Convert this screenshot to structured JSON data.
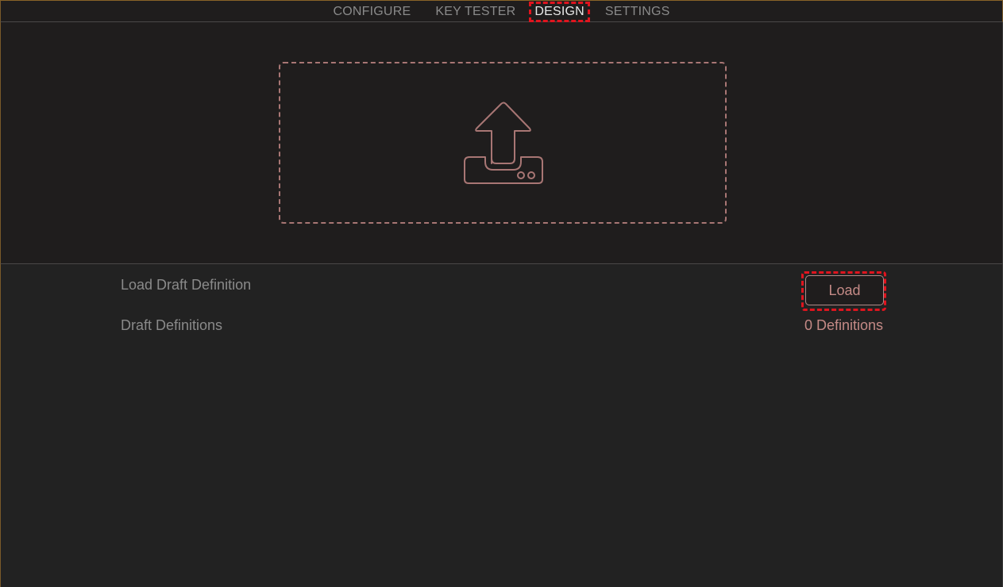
{
  "nav": {
    "tabs": [
      {
        "label": "CONFIGURE",
        "active": false
      },
      {
        "label": "KEY TESTER",
        "active": false
      },
      {
        "label": "DESIGN",
        "active": true
      },
      {
        "label": "SETTINGS",
        "active": false
      }
    ]
  },
  "upload": {
    "icon": "upload-tray-icon"
  },
  "settings": {
    "load_draft": {
      "label": "Load Draft Definition",
      "button_label": "Load"
    },
    "draft_definitions": {
      "label": "Draft Definitions",
      "value": "0 Definitions"
    }
  },
  "colors": {
    "accent": "#c48a86",
    "background": "#222222",
    "panel": "#1f1d1d",
    "highlight": "#e0141e",
    "muted_text": "#8a8a8a"
  }
}
